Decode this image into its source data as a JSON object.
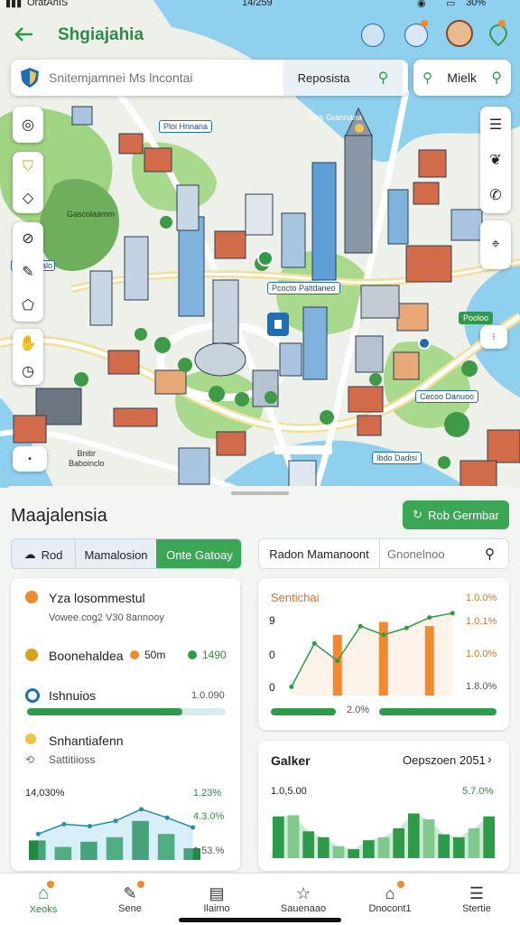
{
  "status_bar": {
    "carrier": "OratAnIS",
    "time": "14/259",
    "battery": "30%"
  },
  "header": {
    "title": "Shgiajahia"
  },
  "search": {
    "placeholder": "Snitemjamnei Ms lncontai",
    "action_label": "Reposista",
    "secondary_label": "Mielk"
  },
  "map": {
    "labels": [
      "Ploi Hnnana",
      "Toss Grannana",
      "Gascolaamm",
      "Samnntalo",
      "Pcocto Paltdaneo",
      "Pooloo",
      "Cecoo Danuoo",
      "Ibdo Dadisi",
      "Bnitir",
      "Baboinclo"
    ]
  },
  "sheet": {
    "title": "Maajalensia",
    "primary_button": "Rob Germbar",
    "segments": [
      "Rod",
      "Mamalosion",
      "Onte Gatoay"
    ],
    "selected_segment": 2,
    "filter": {
      "label": "Radon Mamanoont",
      "placeholder": "Gnonelnoo"
    },
    "summary": {
      "item1_title": "Yza losommestul",
      "item1_subtitle": "Vowee.cog2 V30 8annooy",
      "item2_label": "Boonehaldea",
      "item2_value_a": "50m",
      "item2_value_b": "1490",
      "item3_label": "Ishnuios",
      "item3_value": "1.0.090",
      "item3_progress": 0.78,
      "item4_title": "Snhantiafenn",
      "item4_subtitle": "Sattitiioss"
    },
    "left_chart": {
      "top_left": "14,030%",
      "label_a": "1.23%",
      "label_b": "4.3.0%",
      "label_c": "1.53.%"
    },
    "right_top_chart": {
      "title": "Sentichai",
      "y_labels": [
        "1.0.0%",
        "1.0.1%",
        "1.0.0%",
        "1.8.0%"
      ],
      "left_labels": [
        "9",
        "0",
        "0"
      ],
      "caption": "2.0%"
    },
    "right_bottom_chart": {
      "title": "Galker",
      "date": "Oepszoen 2051",
      "left_value": "1.0,5.00",
      "right_value": "5.7.0%"
    }
  },
  "chart_data": [
    {
      "type": "line",
      "title": "",
      "x": [
        1,
        2,
        3,
        4,
        5,
        6,
        7
      ],
      "values": [
        40,
        55,
        52,
        60,
        78,
        65,
        50
      ],
      "bars": [
        30,
        20,
        28,
        35,
        60,
        40,
        18
      ]
    },
    {
      "type": "line",
      "title": "Sentichai",
      "x": [
        1,
        2,
        3,
        4,
        5,
        6,
        7,
        8
      ],
      "values": [
        10,
        60,
        40,
        80,
        70,
        78,
        90,
        95
      ],
      "bars": [
        0,
        0,
        70,
        0,
        85,
        0,
        80,
        0
      ]
    },
    {
      "type": "bar",
      "title": "Galker",
      "values": [
        70,
        72,
        45,
        35,
        20,
        15,
        30,
        35,
        50,
        75,
        65,
        40,
        35,
        50,
        70
      ]
    }
  ],
  "nav": {
    "items": [
      "Xeoks",
      "Sene",
      "Ilaimo",
      "Sauenaao",
      "Dnocont1",
      "Stertie"
    ],
    "active": 0
  },
  "colors": {
    "accent": "#2e9b4a",
    "orange": "#f08a2e",
    "blue": "#1f6fb0",
    "water": "#8fd0ef"
  }
}
